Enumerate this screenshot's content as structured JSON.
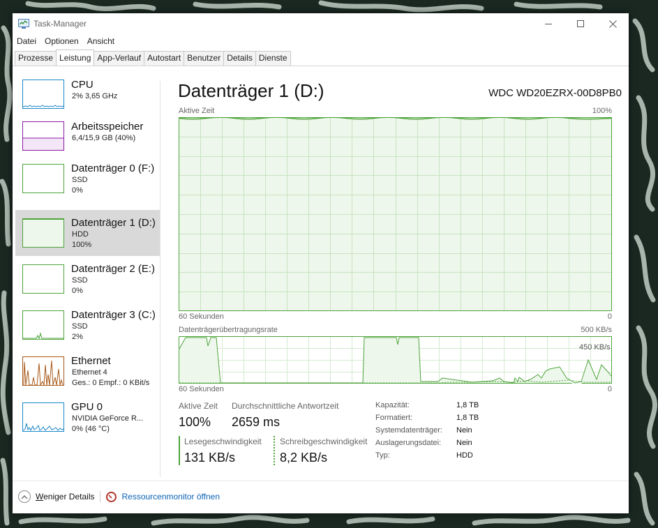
{
  "window": {
    "title": "Task-Manager",
    "controls": {
      "minimize": "minimize-icon",
      "maximize": "maximize-icon",
      "close": "close-icon"
    }
  },
  "menu": [
    "Datei",
    "Optionen",
    "Ansicht"
  ],
  "tabs": [
    "Prozesse",
    "Leistung",
    "App-Verlauf",
    "Autostart",
    "Benutzer",
    "Details",
    "Dienste"
  ],
  "active_tab": "Leistung",
  "sidebar": {
    "items": [
      {
        "title": "CPU",
        "lines": [
          "2% 3,65 GHz"
        ]
      },
      {
        "title": "Arbeitsspeicher",
        "lines": [
          "6,4/15,9 GB (40%)"
        ]
      },
      {
        "title": "Datenträger 0 (F:)",
        "lines": [
          "SSD",
          "0%"
        ]
      },
      {
        "title": "Datenträger 1 (D:)",
        "lines": [
          "HDD",
          "100%"
        ]
      },
      {
        "title": "Datenträger 2 (E:)",
        "lines": [
          "SSD",
          "0%"
        ]
      },
      {
        "title": "Datenträger 3 (C:)",
        "lines": [
          "SSD",
          "2%"
        ]
      },
      {
        "title": "Ethernet",
        "lines": [
          "Ethernet 4",
          "Ges.: 0 Empf.: 0 KBit/s"
        ]
      },
      {
        "title": "GPU 0",
        "lines": [
          "NVIDIA GeForce R...",
          "0% (46 °C)"
        ]
      }
    ],
    "selected_index": 3
  },
  "main": {
    "title": "Datenträger 1 (D:)",
    "model": "WDC WD20EZRX-00D8PB0",
    "active_graph": {
      "label": "Aktive Zeit",
      "max_label": "100%",
      "time_label": "60 Sekunden",
      "min_label": "0"
    },
    "rate_graph": {
      "label": "Datenträgerübertragungsrate",
      "max_label": "500 KB/s",
      "secondary_label": "450 KB/s",
      "time_label": "60 Sekunden",
      "min_label": "0"
    },
    "stats": {
      "active_time_label": "Aktive Zeit",
      "active_time_value": "100%",
      "avg_response_label": "Durchschnittliche Antwortzeit",
      "avg_response_value": "2659 ms",
      "read_speed_label": "Lesegeschwindigkeit",
      "read_speed_value": "131 KB/s",
      "write_speed_label": "Schreibgeschwindigkeit",
      "write_speed_value": "8,2 KB/s"
    },
    "properties": [
      {
        "label": "Kapazität:",
        "value": "1,8 TB"
      },
      {
        "label": "Formatiert:",
        "value": "1,8 TB"
      },
      {
        "label": "Systemdatenträger:",
        "value": "Nein"
      },
      {
        "label": "Auslagerungsdatei:",
        "value": "Nein"
      },
      {
        "label": "Typ:",
        "value": "HDD"
      }
    ]
  },
  "footer": {
    "fewer_details_prefix": "W",
    "fewer_details_rest": "eniger Details",
    "resource_monitor": "Ressourcenmonitor öffnen"
  },
  "colors": {
    "disk_green": "#4da33a",
    "disk_fill": "#eef7ec",
    "cpu_blue": "#1a86c8",
    "memory_purple": "#8a1aa3",
    "ethernet_orange": "#a75716",
    "link_blue": "#0c62b4"
  }
}
